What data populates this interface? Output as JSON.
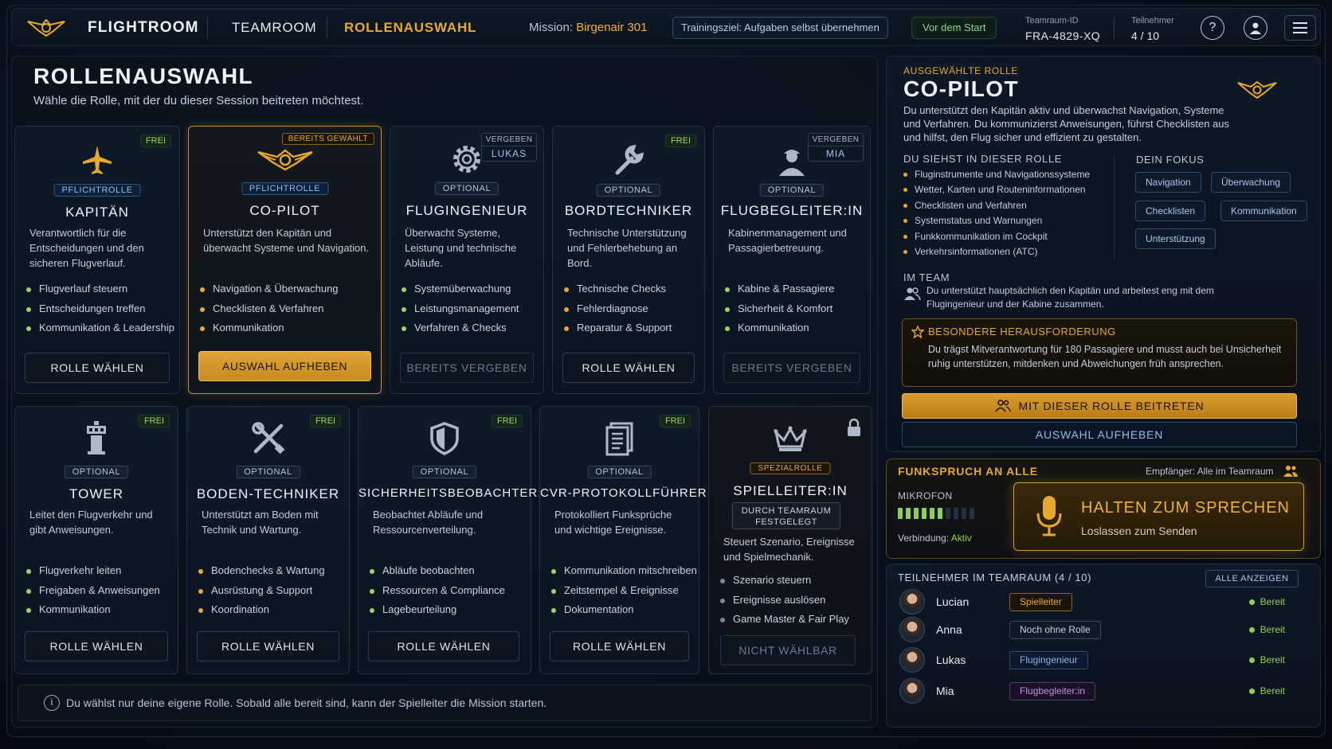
{
  "topbar": {
    "brand": "FLIGHTROOM",
    "nav_team": "TEAMROOM",
    "nav_role": "ROLLENAUSWAHL",
    "mission_label": "Mission:",
    "mission_value": "Birgenair 301",
    "training": "Trainingsziel: Aufgaben selbst übernehmen",
    "status": "Vor dem Start",
    "team_id_label": "Teamraum-ID",
    "team_id_value": "FRA-4829-XQ",
    "participants_label": "Teilnehmer",
    "participants_value": "4 / 10",
    "help_icon": "question-icon",
    "user_icon": "user-icon",
    "menu_icon": "hamburger-icon"
  },
  "page": {
    "title": "ROLLENAUSWAHL",
    "subtitle": "Wähle die Rolle, mit der du dieser Session beitreten möchtest."
  },
  "cards": [
    {
      "title": "KAPITÄN",
      "badge": "FREI",
      "tag": "PFLICHTROLLE",
      "desc": "Verantwortlich für die Entscheidungen und den sicheren Flugverlauf.",
      "items": [
        "Flugverlauf steuern",
        "Entscheidungen treffen",
        "Kommunikation & Leadership"
      ],
      "button": "ROLLE WÄHLEN",
      "icon": "airplane-icon"
    },
    {
      "title": "CO-PILOT",
      "badge": "BEREITS GEWÄHLT",
      "tag": "PFLICHTROLLE",
      "desc": "Unterstützt den Kapitän und überwacht Systeme und Navigation.",
      "items": [
        "Navigation & Überwachung",
        "Checklisten & Verfahren",
        "Kommunikation"
      ],
      "button": "AUSWAHL AUFHEBEN",
      "icon": "wings-icon"
    },
    {
      "title": "FLUGINGENIEUR",
      "badge": "VERGEBEN",
      "badge_user": "LUKAS",
      "tag": "OPTIONAL",
      "desc": "Überwacht Systeme, Leistung und technische Abläufe.",
      "items": [
        "Systemüberwachung",
        "Leistungsmanagement",
        "Verfahren & Checks"
      ],
      "button": "BEREITS VERGEBEN",
      "icon": "gear-icon"
    },
    {
      "title": "BORDTECHNIKER",
      "badge": "FREI",
      "tag": "OPTIONAL",
      "desc": "Technische Unterstützung und Fehlerbehebung an Bord.",
      "items": [
        "Technische Checks",
        "Fehlerdiagnose",
        "Reparatur & Support"
      ],
      "button": "ROLLE WÄHLEN",
      "icon": "wrench-icon"
    },
    {
      "title": "FLUGBEGLEITER:IN",
      "badge": "VERGEBEN",
      "badge_user": "MIA",
      "tag": "OPTIONAL",
      "desc": "Kabinenmanagement und Passagierbetreuung.",
      "items": [
        "Kabine & Passagiere",
        "Sicherheit & Komfort",
        "Kommunikation"
      ],
      "button": "BEREITS VERGEBEN",
      "icon": "attendant-icon"
    },
    {
      "title": "TOWER",
      "badge": "FREI",
      "tag": "OPTIONAL",
      "desc": "Leitet den Flugverkehr und gibt Anweisungen.",
      "items": [
        "Flugverkehr leiten",
        "Freigaben & Anweisungen",
        "Kommunikation"
      ],
      "button": "ROLLE WÄHLEN",
      "icon": "tower-icon"
    },
    {
      "title": "BODEN-TECHNIKER",
      "badge": "FREI",
      "tag": "OPTIONAL",
      "desc": "Unterstützt am Boden mit Technik und Wartung.",
      "items": [
        "Bodenchecks & Wartung",
        "Ausrüstung & Support",
        "Koordination"
      ],
      "button": "ROLLE WÄHLEN",
      "icon": "tools-icon"
    },
    {
      "title": "SICHERHEITSBEOBACHTER:IN",
      "badge": "FREI",
      "tag": "OPTIONAL",
      "desc": "Beobachtet Abläufe und Ressourcenverteilung.",
      "items": [
        "Abläufe beobachten",
        "Ressourcen & Compliance",
        "Lagebeurteilung"
      ],
      "button": "ROLLE WÄHLEN",
      "icon": "shield-icon"
    },
    {
      "title": "CVR-PROTOKOLLFÜHRER:IN",
      "badge": "FREI",
      "tag": "OPTIONAL",
      "desc": "Protokolliert Funksprüche und wichtige Ereignisse.",
      "items": [
        "Kommunikation mitschreiben",
        "Zeitstempel & Ereignisse",
        "Dokumentation"
      ],
      "button": "ROLLE WÄHLEN",
      "icon": "document-icon"
    },
    {
      "title": "SPIELLEITER:IN",
      "tag": "SPEZIALROLLE",
      "team_label": "DURCH TEAMRAUM FESTGELEGT",
      "desc": "Steuert Szenario, Ereignisse und Spielmechanik.",
      "items": [
        "Szenario steuern",
        "Ereignisse auslösen",
        "Game Master & Fair Play"
      ],
      "button": "NICHT WÄHLBAR",
      "icon": "crown-icon",
      "lock_icon": "lock-icon"
    }
  ],
  "info": "Du wählst nur deine eigene Rolle. Sobald alle bereit sind, kann der Spielleiter die Mission starten.",
  "selected": {
    "label": "AUSGEWÄHLTE ROLLE",
    "title": "CO-PILOT",
    "desc": "Du unterstützt den Kapitän aktiv und überwachst Navigation, Systeme und Verfahren. Du kommunizierst Anweisungen, führst Checklisten aus und hilfst, den Flug sicher und effizient zu gestalten.",
    "sees_title": "DU SIEHST IN DIESER ROLLE",
    "sees": [
      "Fluginstrumente und Navigationssysteme",
      "Wetter, Karten und Routeninformationen",
      "Checklisten und Verfahren",
      "Systemstatus und Warnungen",
      "Funkkommunikation im Cockpit",
      "Verkehrsinformationen (ATC)"
    ],
    "focus_title": "DEIN FOKUS",
    "focus": [
      "Navigation",
      "Überwachung",
      "Checklisten",
      "Kommunikation",
      "Unterstützung"
    ],
    "team_title": "IM TEAM",
    "team_text": "Du unterstützt hauptsächlich den Kapitän und arbeitest eng mit dem Flugingenieur und der Kabine zusammen.",
    "challenge_title": "BESONDERE HERAUSFORDERUNG",
    "challenge_text": "Du trägst Mitverantwortung für 180 Passagiere und musst auch bei Unsicherheit ruhig unterstützen, mitdenken und Abweichungen früh ansprechen.",
    "join_button": "MIT DIESER ROLLE BEITRETEN",
    "clear_button": "AUSWAHL AUFHEBEN"
  },
  "radio": {
    "title": "FUNKSPRUCH AN ALLE",
    "receiver": "Empfänger: Alle im Teamraum",
    "mic_label": "MIKROFON",
    "mic_level": 0.6,
    "connection_label": "Verbindung:",
    "connection_value": "Aktiv",
    "ptt_title": "HALTEN ZUM SPRECHEN",
    "ptt_sub": "Loslassen zum Senden"
  },
  "participants": {
    "title": "TEILNEHMER IM TEAMRAUM (4 / 10)",
    "show_all": "ALLE ANZEIGEN",
    "rows": [
      {
        "name": "Lucian",
        "role": "Spielleiter",
        "status": "Bereit",
        "role_color": "#e8a82c"
      },
      {
        "name": "Anna",
        "role": "Noch ohne Rolle",
        "status": "Bereit",
        "role_color": "#c3cedb"
      },
      {
        "name": "Lukas",
        "role": "Flugingenieur",
        "status": "Bereit",
        "role_color": "#7fb6f0"
      },
      {
        "name": "Mia",
        "role": "Flugbegleiter:in",
        "status": "Bereit",
        "role_color": "#c58ee8"
      }
    ]
  }
}
